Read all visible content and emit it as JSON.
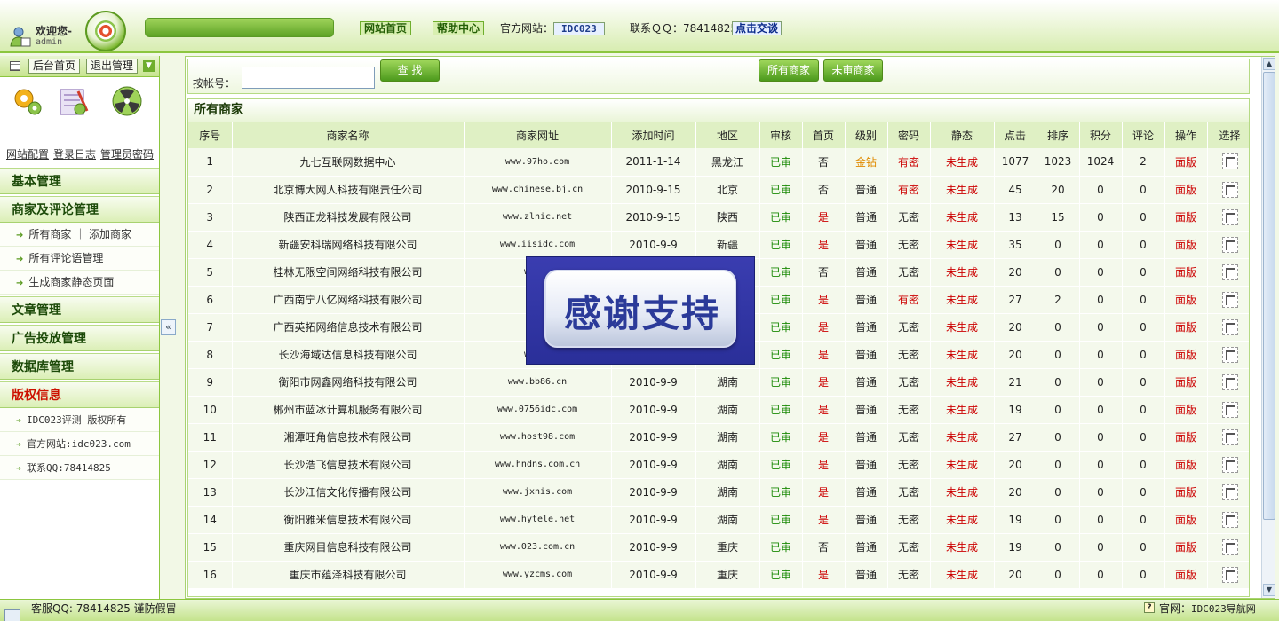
{
  "header": {
    "welcome": "欢迎您-",
    "user": "admin",
    "nav_home": "网站首页",
    "nav_help": "帮助中心",
    "official_label": "官方网站：",
    "official_site": "IDC023",
    "qq_label": "联系ＱＱ：78414825",
    "chat": "点击交谈"
  },
  "sidebar": {
    "top_home": "后台首页",
    "top_logout": "退出管理",
    "tools": [
      "网站配置",
      "登录日志",
      "管理员密码"
    ],
    "menu": [
      {
        "title": "基本管理"
      },
      {
        "title": "商家及评论管理"
      },
      {
        "item": "所有商家 ｜ 添加商家"
      },
      {
        "item": "所有评论语管理"
      },
      {
        "item": "生成商家静态页面"
      },
      {
        "title": "文章管理"
      },
      {
        "title": "广告投放管理"
      },
      {
        "title": "数据库管理"
      },
      {
        "title": "版权信息"
      },
      {
        "item": "IDC023评测 版权所有"
      },
      {
        "item": "官方网站:idc023.com"
      },
      {
        "item": "联系QQ:78414825"
      }
    ]
  },
  "search": {
    "label": "按帐号：",
    "value": "",
    "find": "查 找",
    "all": "所有商家",
    "unreviewed": "未审商家"
  },
  "list": {
    "title": "所有商家",
    "columns": [
      "序号",
      "商家名称",
      "商家网址",
      "添加时间",
      "地区",
      "审核",
      "首页",
      "级别",
      "密码",
      "静态",
      "点击",
      "排序",
      "积分",
      "评论",
      "操作",
      "选择"
    ],
    "rows": [
      [
        "1",
        "九七互联网数据中心",
        "www.97ho.com",
        "2011-1-14",
        "黑龙江",
        "已审",
        "否",
        "金钻",
        "有密",
        "未生成",
        "1077",
        "1023",
        "1024",
        "2",
        "面版"
      ],
      [
        "2",
        "北京博大网人科技有限责任公司",
        "www.chinese.bj.cn",
        "2010-9-15",
        "北京",
        "已审",
        "否",
        "普通",
        "有密",
        "未生成",
        "45",
        "20",
        "0",
        "0",
        "面版"
      ],
      [
        "3",
        "陕西正龙科技发展有限公司",
        "www.zlnic.net",
        "2010-9-15",
        "陕西",
        "已审",
        "是",
        "普通",
        "无密",
        "未生成",
        "13",
        "15",
        "0",
        "0",
        "面版"
      ],
      [
        "4",
        "新疆安科瑞网络科技有限公司",
        "www.iisidc.com",
        "2010-9-9",
        "新疆",
        "已审",
        "是",
        "普通",
        "无密",
        "未生成",
        "35",
        "0",
        "0",
        "0",
        "面版"
      ],
      [
        "5",
        "桂林无限空间网络科技有限公司",
        "www.w",
        "",
        "",
        "已审",
        "否",
        "普通",
        "无密",
        "未生成",
        "20",
        "0",
        "0",
        "0",
        "面版"
      ],
      [
        "6",
        "广西南宁八亿网络科技有限公司",
        "www.",
        "",
        "",
        "已审",
        "是",
        "普通",
        "有密",
        "未生成",
        "27",
        "2",
        "0",
        "0",
        "面版"
      ],
      [
        "7",
        "广西英拓网络信息技术有限公司",
        "www.",
        "",
        "",
        "已审",
        "是",
        "普通",
        "无密",
        "未生成",
        "20",
        "0",
        "0",
        "0",
        "面版"
      ],
      [
        "8",
        "长沙海域达信息科技有限公司",
        "www.l",
        "",
        "",
        "已审",
        "是",
        "普通",
        "无密",
        "未生成",
        "20",
        "0",
        "0",
        "0",
        "面版"
      ],
      [
        "9",
        "衡阳市网鑫网络科技有限公司",
        "www.bb86.cn",
        "2010-9-9",
        "湖南",
        "已审",
        "是",
        "普通",
        "无密",
        "未生成",
        "21",
        "0",
        "0",
        "0",
        "面版"
      ],
      [
        "10",
        "郴州市蓝冰计算机服务有限公司",
        "www.0756idc.com",
        "2010-9-9",
        "湖南",
        "已审",
        "是",
        "普通",
        "无密",
        "未生成",
        "19",
        "0",
        "0",
        "0",
        "面版"
      ],
      [
        "11",
        "湘潭旺角信息技术有限公司",
        "www.host98.com",
        "2010-9-9",
        "湖南",
        "已审",
        "是",
        "普通",
        "无密",
        "未生成",
        "27",
        "0",
        "0",
        "0",
        "面版"
      ],
      [
        "12",
        "长沙浩飞信息技术有限公司",
        "www.hndns.com.cn",
        "2010-9-9",
        "湖南",
        "已审",
        "是",
        "普通",
        "无密",
        "未生成",
        "20",
        "0",
        "0",
        "0",
        "面版"
      ],
      [
        "13",
        "长沙江信文化传播有限公司",
        "www.jxnis.com",
        "2010-9-9",
        "湖南",
        "已审",
        "是",
        "普通",
        "无密",
        "未生成",
        "20",
        "0",
        "0",
        "0",
        "面版"
      ],
      [
        "14",
        "衡阳雅米信息技术有限公司",
        "www.hytele.net",
        "2010-9-9",
        "湖南",
        "已审",
        "是",
        "普通",
        "无密",
        "未生成",
        "19",
        "0",
        "0",
        "0",
        "面版"
      ],
      [
        "15",
        "重庆网目信息科技有限公司",
        "www.023.com.cn",
        "2010-9-9",
        "重庆",
        "已审",
        "否",
        "普通",
        "无密",
        "未生成",
        "19",
        "0",
        "0",
        "0",
        "面版"
      ],
      [
        "16",
        "重庆市蕴泽科技有限公司",
        "www.yzcms.com",
        "2010-9-9",
        "重庆",
        "已审",
        "是",
        "普通",
        "无密",
        "未生成",
        "20",
        "0",
        "0",
        "0",
        "面版"
      ]
    ]
  },
  "overlay": {
    "text": "感谢支持"
  },
  "footer": {
    "left": "客服QQ: 78414825 谨防假冒",
    "right_label": "官网：",
    "right_site": "IDC023导航网"
  },
  "colors": {
    "accent": "#8cc63f",
    "approved": "#1a8a06",
    "alert": "#cc0000",
    "gold": "#e08a00"
  }
}
